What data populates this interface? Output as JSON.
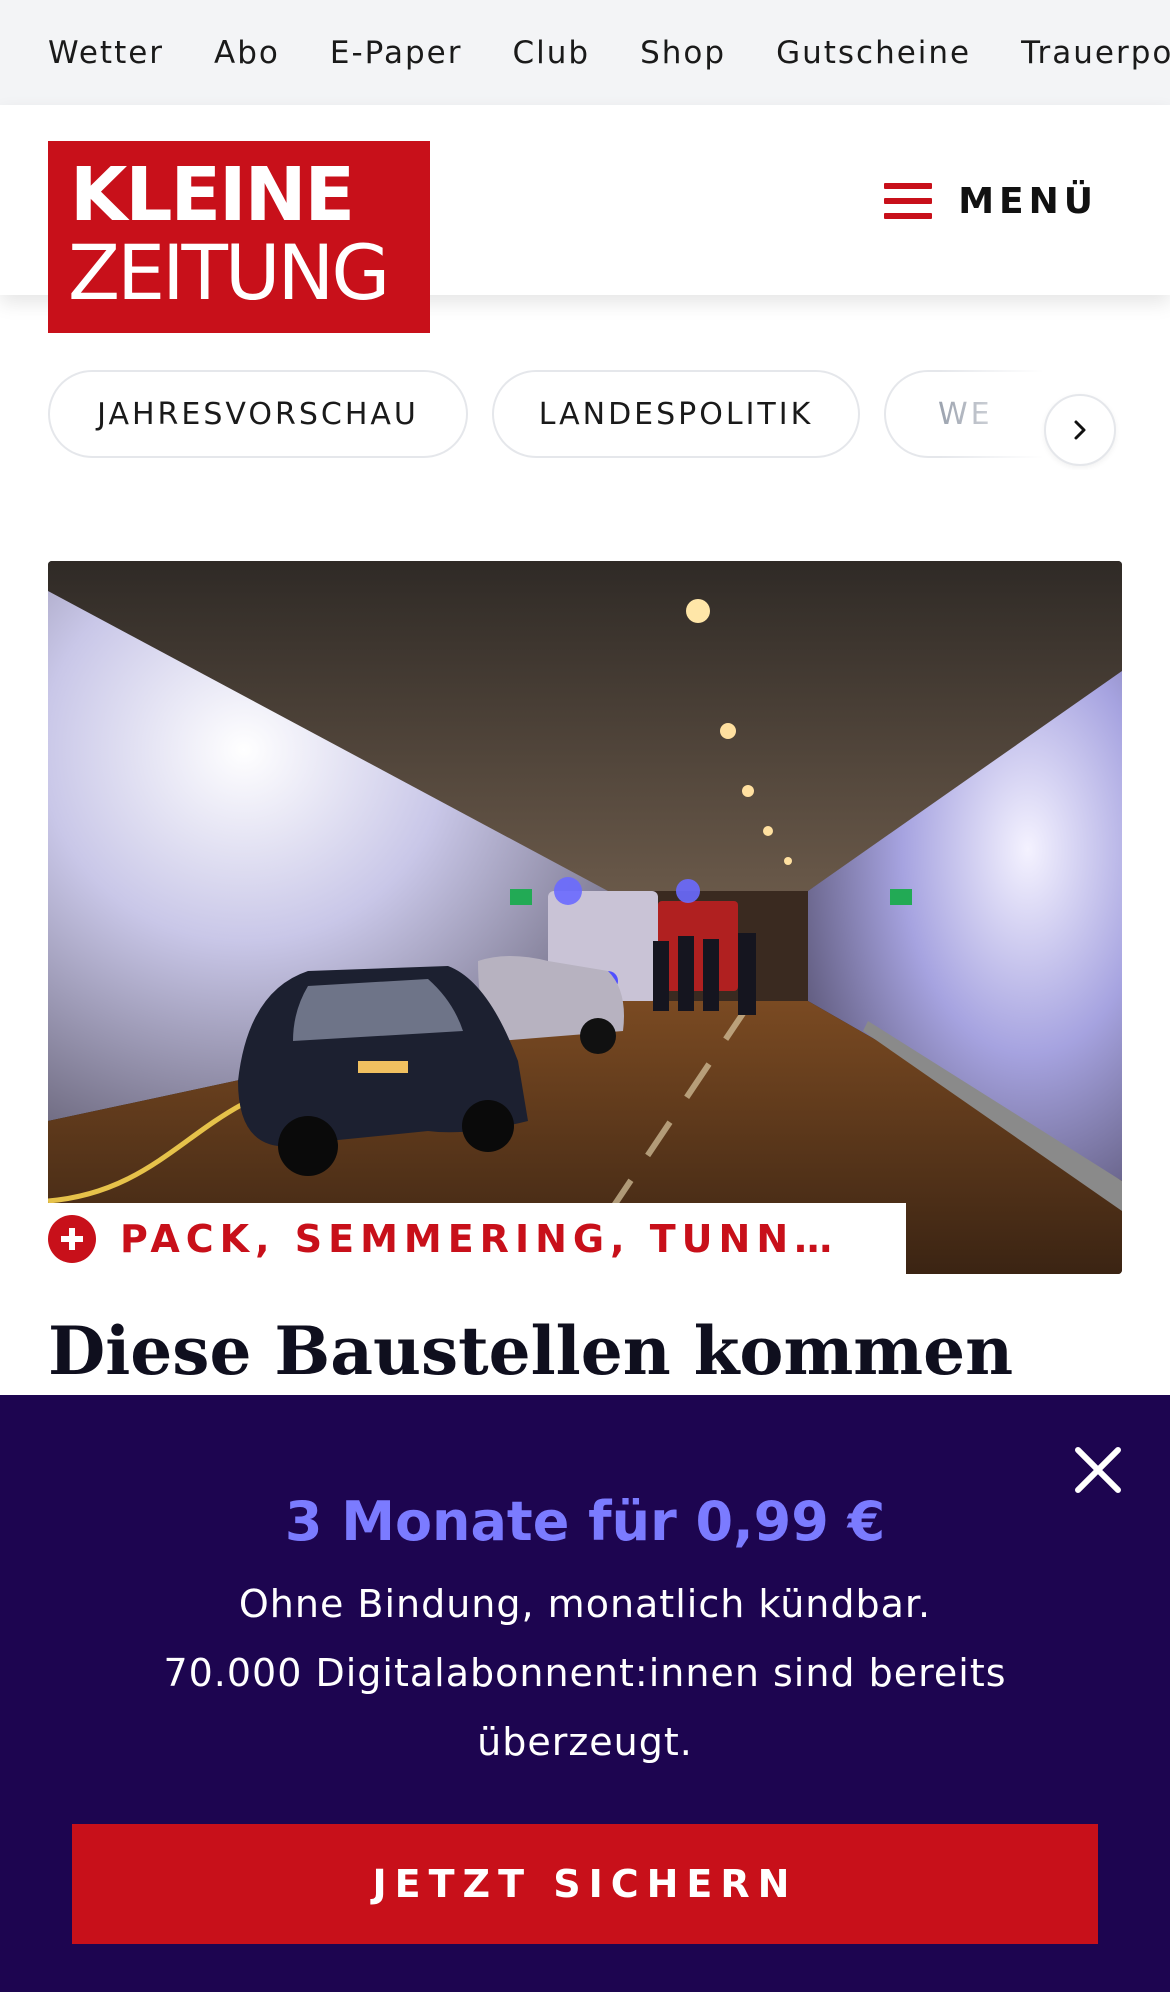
{
  "topnav": {
    "items": [
      "Wetter",
      "Abo",
      "E-Paper",
      "Club",
      "Shop",
      "Gutscheine",
      "Trauerportal"
    ]
  },
  "header": {
    "logo_line1": "KLEINE",
    "logo_line2": "ZEITUNG",
    "menu_label": "MENÜ"
  },
  "chips": {
    "items": [
      "JAHRESVORSCHAU",
      "LANDESPOLITIK",
      "WE"
    ]
  },
  "article": {
    "kicker": "PACK, SEMMERING, TUNNELKET…",
    "headline": "Diese Baustellen kommen"
  },
  "promo": {
    "title": "3 Monate für 0,99 €",
    "line1": "Ohne Bindung, monatlich kündbar.",
    "line2": "70.000 Digitalabonnent:innen sind bereits überzeugt.",
    "cta_label": "JETZT SICHERN"
  },
  "colors": {
    "brand_red": "#c8101a",
    "promo_bg": "#1d0550",
    "promo_accent": "#7b7bff"
  },
  "icons": {
    "menu": "hamburger-icon",
    "chip_next": "chevron-right-icon",
    "kicker": "plus-icon",
    "close": "close-icon"
  }
}
